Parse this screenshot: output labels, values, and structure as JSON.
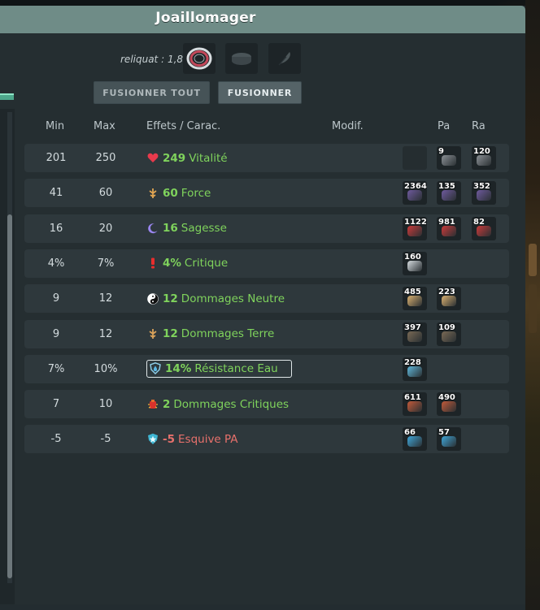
{
  "window": {
    "title": "Joaillomager"
  },
  "header": {
    "reliquat": "reliquat : 1,8",
    "fuse_all_label": "FUSIONNER TOUT",
    "fuse_label": "FUSIONNER"
  },
  "table": {
    "columns": {
      "min": "Min",
      "max": "Max",
      "effects": "Effets / Carac.",
      "modif": "Modif.",
      "pa": "Pa",
      "ra": "Ra"
    },
    "rows": [
      {
        "min": "201",
        "max": "250",
        "value": "249",
        "label": "Vitalité",
        "icon": "heart-icon",
        "color": "#7fd35c",
        "runes": [
          null,
          "9",
          "120"
        ]
      },
      {
        "min": "41",
        "max": "60",
        "value": "60",
        "label": "Force",
        "icon": "force-icon",
        "color": "#7fd35c",
        "runes": [
          "2364",
          "135",
          "352"
        ]
      },
      {
        "min": "16",
        "max": "20",
        "value": "16",
        "label": "Sagesse",
        "icon": "moon-icon",
        "color": "#7fd35c",
        "runes": [
          "1122",
          "981",
          "82"
        ]
      },
      {
        "min": "4%",
        "max": "7%",
        "value": "4%",
        "label": "Critique",
        "icon": "exclamation-icon",
        "color": "#7fd35c",
        "runes": [
          "160"
        ]
      },
      {
        "min": "9",
        "max": "12",
        "value": "12",
        "label": "Dommages Neutre",
        "icon": "yin-yang-icon",
        "color": "#7fd35c",
        "runes": [
          "485",
          "223"
        ]
      },
      {
        "min": "9",
        "max": "12",
        "value": "12",
        "label": "Dommages Terre",
        "icon": "earth-icon",
        "color": "#7fd35c",
        "runes": [
          "397",
          "109"
        ]
      },
      {
        "min": "7%",
        "max": "10%",
        "value": "14%",
        "label": "Résistance Eau",
        "icon": "water-shield-icon",
        "color": "#7fd35c",
        "runes": [
          "228"
        ]
      },
      {
        "min": "7",
        "max": "10",
        "value": "2",
        "label": "Dommages Critiques",
        "icon": "crit-damage-icon",
        "color": "#7fd35c",
        "runes": [
          "611",
          "490"
        ]
      },
      {
        "min": "-5",
        "max": "-5",
        "value": "-5",
        "label": "Esquive PA",
        "icon": "dodge-pa-icon",
        "color": "#e8716c",
        "runes": [
          "66",
          "57"
        ]
      }
    ]
  }
}
